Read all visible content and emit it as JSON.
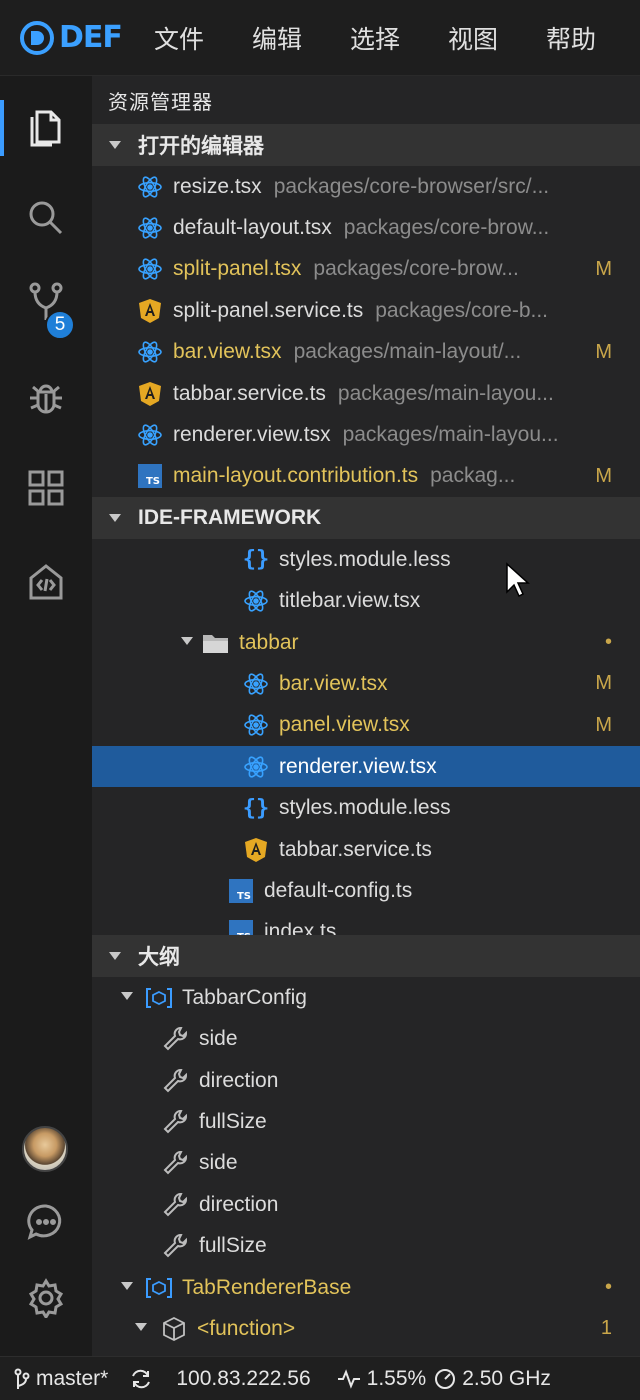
{
  "app": {
    "logo_text": "DEF"
  },
  "menu": [
    "文件",
    "编辑",
    "选择",
    "视图",
    "帮助"
  ],
  "activity": {
    "scm_badge": "5"
  },
  "explorer": {
    "title": "资源管理器",
    "open_editors": {
      "header": "打开的编辑器",
      "items": [
        {
          "name": "resize.tsx",
          "path": "packages/core-browser/src/...",
          "icon": "react-icon",
          "modified": false,
          "status": ""
        },
        {
          "name": "default-layout.tsx",
          "path": "packages/core-brow...",
          "icon": "react-icon",
          "modified": false,
          "status": ""
        },
        {
          "name": "split-panel.tsx",
          "path": "packages/core-brow...",
          "icon": "react-icon",
          "modified": true,
          "status": "M"
        },
        {
          "name": "split-panel.service.ts",
          "path": "packages/core-b...",
          "icon": "angular-icon",
          "modified": false,
          "status": ""
        },
        {
          "name": "bar.view.tsx",
          "path": "packages/main-layout/...",
          "icon": "react-icon",
          "modified": true,
          "status": "M"
        },
        {
          "name": "tabbar.service.ts",
          "path": "packages/main-layou...",
          "icon": "angular-icon",
          "modified": false,
          "status": ""
        },
        {
          "name": "renderer.view.tsx",
          "path": "packages/main-layou...",
          "icon": "react-icon",
          "modified": false,
          "status": ""
        },
        {
          "name": "main-layout.contribution.ts",
          "path": "packag...",
          "icon": "typescript-icon",
          "modified": true,
          "status": "M"
        }
      ]
    },
    "workspace": {
      "header": "IDE-FRAMEWORK",
      "items": [
        {
          "name": "styles.module.less",
          "icon": "braces-icon",
          "indent": 150,
          "modified": false,
          "status": ""
        },
        {
          "name": "titlebar.view.tsx",
          "icon": "react-icon",
          "indent": 150,
          "modified": false,
          "status": ""
        },
        {
          "name": "tabbar",
          "icon": "folder-icon",
          "indent": 110,
          "modified": true,
          "status": "•",
          "expanded": true
        },
        {
          "name": "bar.view.tsx",
          "icon": "react-icon",
          "indent": 150,
          "modified": true,
          "status": "M"
        },
        {
          "name": "panel.view.tsx",
          "icon": "react-icon",
          "indent": 150,
          "modified": true,
          "status": "M"
        },
        {
          "name": "renderer.view.tsx",
          "icon": "react-icon",
          "indent": 150,
          "modified": false,
          "status": "",
          "selected": true
        },
        {
          "name": "styles.module.less",
          "icon": "braces-icon",
          "indent": 150,
          "modified": false,
          "status": ""
        },
        {
          "name": "tabbar.service.ts",
          "icon": "angular-icon",
          "indent": 150,
          "modified": false,
          "status": ""
        },
        {
          "name": "default-config.ts",
          "icon": "typescript-icon",
          "indent": 135,
          "modified": false,
          "status": ""
        },
        {
          "name": "index.ts",
          "icon": "typescript-icon",
          "indent": 135,
          "modified": false,
          "status": ""
        }
      ]
    },
    "outline": {
      "header": "大纲",
      "items": [
        {
          "name": "TabbarConfig",
          "icon": "class-icon",
          "indent": 25,
          "modified": false,
          "status": "",
          "expanded": true
        },
        {
          "name": "side",
          "icon": "wrench-icon",
          "indent": 70,
          "modified": false,
          "status": ""
        },
        {
          "name": "direction",
          "icon": "wrench-icon",
          "indent": 70,
          "modified": false,
          "status": ""
        },
        {
          "name": "fullSize",
          "icon": "wrench-icon",
          "indent": 70,
          "modified": false,
          "status": ""
        },
        {
          "name": "side",
          "icon": "wrench-icon",
          "indent": 70,
          "modified": false,
          "status": ""
        },
        {
          "name": "direction",
          "icon": "wrench-icon",
          "indent": 70,
          "modified": false,
          "status": ""
        },
        {
          "name": "fullSize",
          "icon": "wrench-icon",
          "indent": 70,
          "modified": false,
          "status": ""
        },
        {
          "name": "TabRendererBase",
          "icon": "class-icon",
          "indent": 25,
          "modified": true,
          "status": "•",
          "expanded": true
        },
        {
          "name": "<function>",
          "icon": "cube-icon",
          "indent": 40,
          "modified": true,
          "status": "1",
          "expanded": true
        }
      ]
    }
  },
  "statusbar": {
    "branch": "master*",
    "ip": "100.83.222.56",
    "cpu": "1.55%",
    "freq": "2.50 GHz"
  }
}
